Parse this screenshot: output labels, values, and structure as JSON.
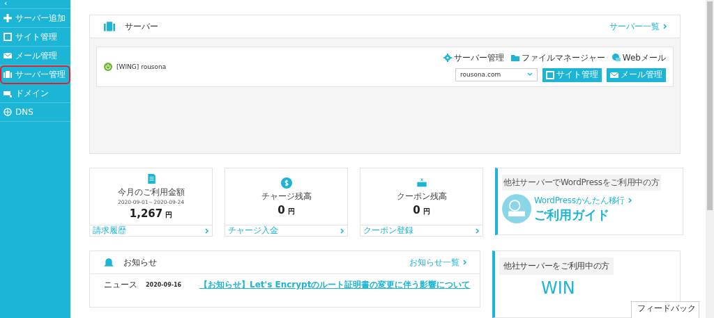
{
  "sidebar": {
    "collapse": "‹",
    "items": [
      {
        "label": "サーバー追加",
        "highlighted": false
      },
      {
        "label": "サイト管理",
        "highlighted": false
      },
      {
        "label": "メール管理",
        "highlighted": false
      },
      {
        "label": "サーバー管理",
        "highlighted": true
      },
      {
        "label": "ドメイン",
        "highlighted": false
      },
      {
        "label": "DNS",
        "highlighted": false
      }
    ]
  },
  "server_panel": {
    "title": "サーバー",
    "list_link": "サーバー一覧",
    "server": {
      "name": "[WING] rousona",
      "online": true,
      "tools": [
        "サーバー管理",
        "ファイルマネージャー",
        "Webメール"
      ],
      "domain": "rousona.com",
      "buttons": [
        "サイト管理",
        "メール管理"
      ]
    }
  },
  "stats": [
    {
      "title": "今月のご利用金額",
      "period": "2020-09-01～2020-09-24",
      "amount": "1,267",
      "unit": "円",
      "link": "請求履歴"
    },
    {
      "title": "チャージ残高",
      "amount": "0",
      "unit": "円",
      "link": "チャージ入金"
    },
    {
      "title": "クーポン残高",
      "amount": "0",
      "unit": "円",
      "link": "クーポン登録"
    }
  ],
  "promos": [
    {
      "caption": "他社サーバーでWordPressをご利用中の方",
      "subtitle": "WordPressかんたん移行",
      "headline": "ご利用ガイド"
    },
    {
      "caption": "他社サーバーをご利用中の方",
      "headline": "WIN"
    }
  ],
  "news": {
    "title": "お知らせ",
    "list_link": "お知らせ一覧",
    "items": [
      {
        "category": "ニュース",
        "date": "2020-09-16",
        "title": "【お知らせ】Let's Encryptのルート証明書の変更に伴う影響について"
      }
    ]
  },
  "feedback": "フィードバック"
}
